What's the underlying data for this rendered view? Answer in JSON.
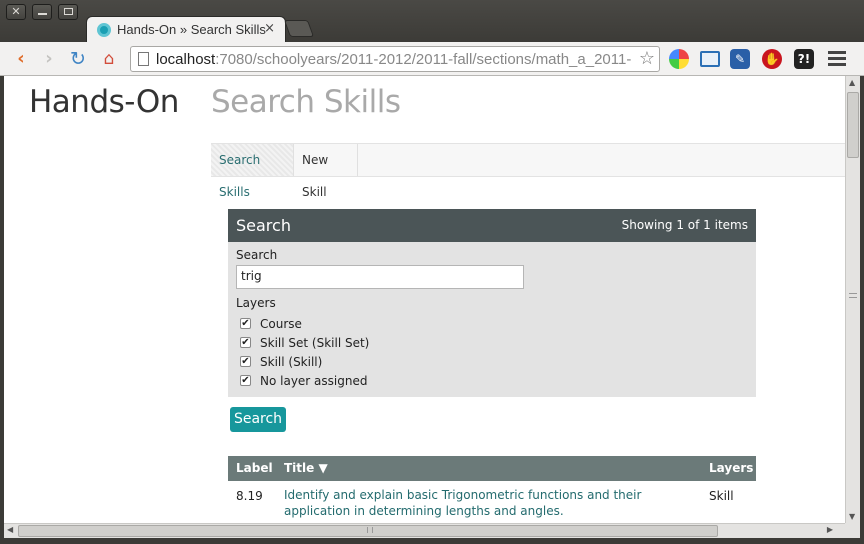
{
  "browser": {
    "tab": {
      "title": "Hands-On » Search Skills",
      "close": "×"
    },
    "url": {
      "host": "localhost",
      "path": ":7080/schoolyears/2011-2012/2011-fall/sections/math_a_2011-"
    },
    "window_buttons": {
      "close": "✕",
      "minimize": "",
      "maximize": ""
    },
    "nav": {
      "back": "‹",
      "forward": "›",
      "reload": "↻",
      "home": "⌂",
      "star": "☆"
    },
    "extensions": {
      "tools": "✎",
      "stop": "✋",
      "help": "?!"
    }
  },
  "page": {
    "brand": "Hands-On",
    "heading": "Search Skills",
    "subnav": [
      {
        "label": "Search Skills"
      },
      {
        "label": "New Skill"
      }
    ],
    "search_panel": {
      "title": "Search",
      "count_text": "Showing 1 of 1 items",
      "search_label": "Search",
      "search_value": "trig",
      "layers_label": "Layers",
      "layers": [
        {
          "label": "Course",
          "checked": true
        },
        {
          "label": "Skill Set (Skill Set)",
          "checked": true
        },
        {
          "label": "Skill (Skill)",
          "checked": true
        },
        {
          "label": "No layer assigned",
          "checked": true
        }
      ]
    },
    "search_button": "Search",
    "results": {
      "columns": {
        "label": "Label",
        "title": "Title ▼",
        "layers": "Layers"
      },
      "rows": [
        {
          "label": "8.19",
          "title": "Identify and explain basic Trigonometric functions and their application in determining lengths and angles.",
          "layers": "Skill"
        }
      ]
    }
  },
  "colors": {
    "panel_header": "#4b5557",
    "table_header": "#6b7a79",
    "button": "#17979c",
    "link": "#236b6e"
  }
}
